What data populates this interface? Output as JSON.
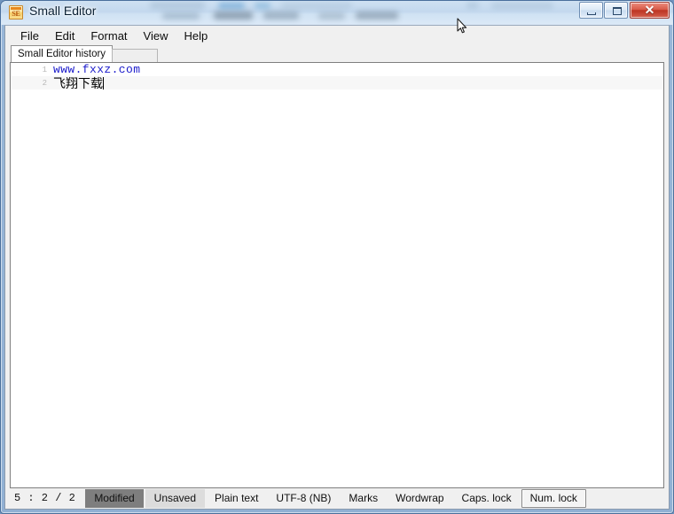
{
  "window": {
    "title": "Small Editor",
    "icon": "small-editor-icon",
    "icon_label": "SE",
    "controls": {
      "minimize": "minimize-icon",
      "maximize": "maximize-icon",
      "close": "✕"
    },
    "accent_close": "#bc3422",
    "glass_color": "#cfe1f2"
  },
  "menubar": {
    "items": [
      {
        "label": "File"
      },
      {
        "label": "Edit"
      },
      {
        "label": "Format"
      },
      {
        "label": "View"
      },
      {
        "label": "Help"
      }
    ]
  },
  "tabs": {
    "active": "Small Editor history",
    "items": [
      {
        "label": "Small Editor history"
      }
    ]
  },
  "editor": {
    "lines": [
      {
        "number": "1",
        "text": "www.fxxz.com",
        "style": "link"
      },
      {
        "number": "2",
        "text": "飞翔下载",
        "style": "cjk"
      }
    ],
    "link_color": "#1c1ccb",
    "text_color": "#000000",
    "linenumber_color": "#b9b9b9",
    "background": "#ffffff"
  },
  "statusbar": {
    "position": "5 : 2 / 2",
    "modified": "Modified",
    "saved_state": "Unsaved",
    "language": "Plain text",
    "encoding": "UTF-8 (NB)",
    "marks": "Marks",
    "wordwrap": "Wordwrap",
    "caps_lock": "Caps. lock",
    "num_lock": "Num. lock"
  }
}
